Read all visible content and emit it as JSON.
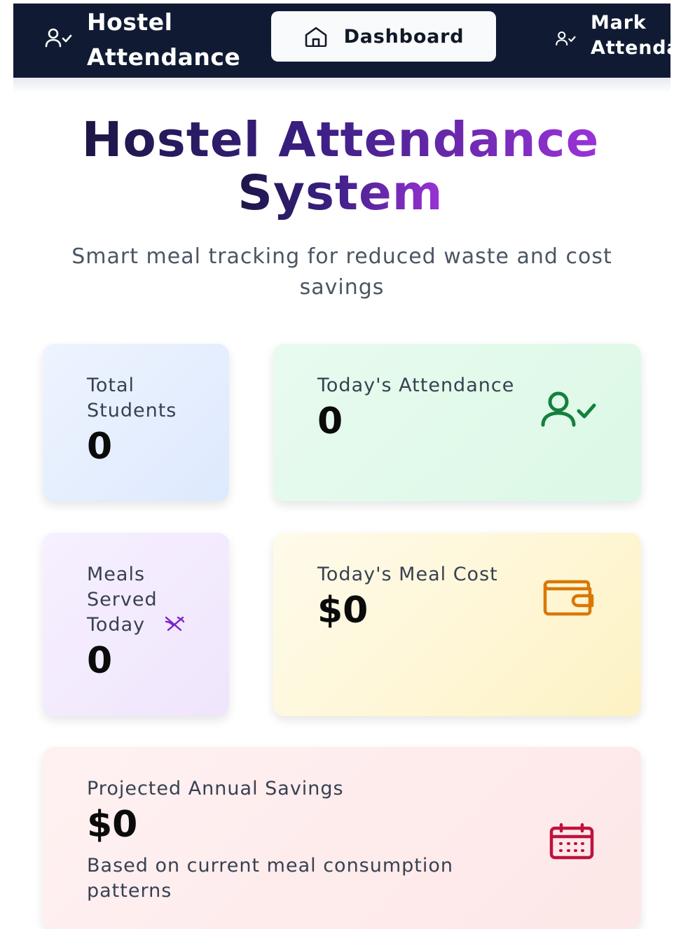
{
  "nav": {
    "brand": "Hostel Attendance",
    "dashboard_label": "Dashboard",
    "mark_label": "Mark\nAttendance"
  },
  "hero": {
    "title_line1": "Hostel Attendance",
    "title_line2": "System",
    "subtitle": "Smart meal tracking for reduced waste and cost savings"
  },
  "stats": {
    "total_students": {
      "label": "Total Students",
      "value": "0"
    },
    "todays_attendance": {
      "label": "Today's Attendance",
      "value": "0",
      "icon": "user-check-icon"
    },
    "meals_served": {
      "label": "Meals Served Today",
      "value": "0",
      "icon": "utensils-crossed-icon"
    },
    "meal_cost": {
      "label": "Today's Meal Cost",
      "value": "$0",
      "icon": "wallet-icon"
    },
    "annual_savings": {
      "label": "Projected Annual Savings",
      "value": "$0",
      "note": "Based on current meal consumption patterns",
      "icon": "calendar-icon"
    }
  },
  "colors": {
    "navbar": "#101b33",
    "attendance_accent": "#15803d",
    "meals_accent": "#7e22ce",
    "cost_accent": "#d97706",
    "savings_accent": "#be123c"
  }
}
